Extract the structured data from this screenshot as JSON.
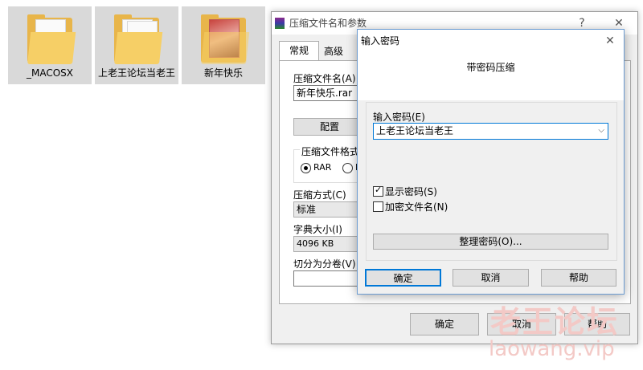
{
  "desktop": {
    "items": [
      {
        "label": "_MACOSX"
      },
      {
        "label": "上老王论坛当老王"
      },
      {
        "label": "新年快乐"
      }
    ]
  },
  "archive_dialog": {
    "title": "压缩文件名和参数",
    "help_glyph": "?",
    "close_glyph": "✕",
    "tabs": [
      "常规",
      "高级"
    ],
    "archive_name_label": "压缩文件名(A)",
    "archive_name_value": "新年快乐.rar",
    "profile_button": "配置",
    "format_label": "压缩文件格式",
    "format_rar": "RAR",
    "format_other_partial": "R",
    "method_label": "压缩方式(C)",
    "method_value": "标准",
    "dict_label": "字典大小(I)",
    "dict_value": "4096 KB",
    "split_label": "切分为分卷(V)",
    "split_value": "",
    "ok": "确定",
    "cancel": "取消",
    "help": "帮助"
  },
  "password_dialog": {
    "title": "输入密码",
    "close_glyph": "✕",
    "heading": "带密码压缩",
    "password_label": "输入密码(E)",
    "password_value": "上老王论坛当老王",
    "show_password": {
      "label": "显示密码(S)",
      "checked": true
    },
    "encrypt_names": {
      "label": "加密文件名(N)",
      "checked": false
    },
    "organize_button": "整理密码(O)...",
    "ok": "确定",
    "cancel": "取消",
    "help": "帮助"
  },
  "watermark": {
    "line1": "老王论坛",
    "line2": "laowang.vip"
  },
  "colors": {
    "focus_blue": "#0078d7",
    "folder_yellow": "#f6cf66",
    "watermark": "#f3c9c6"
  }
}
